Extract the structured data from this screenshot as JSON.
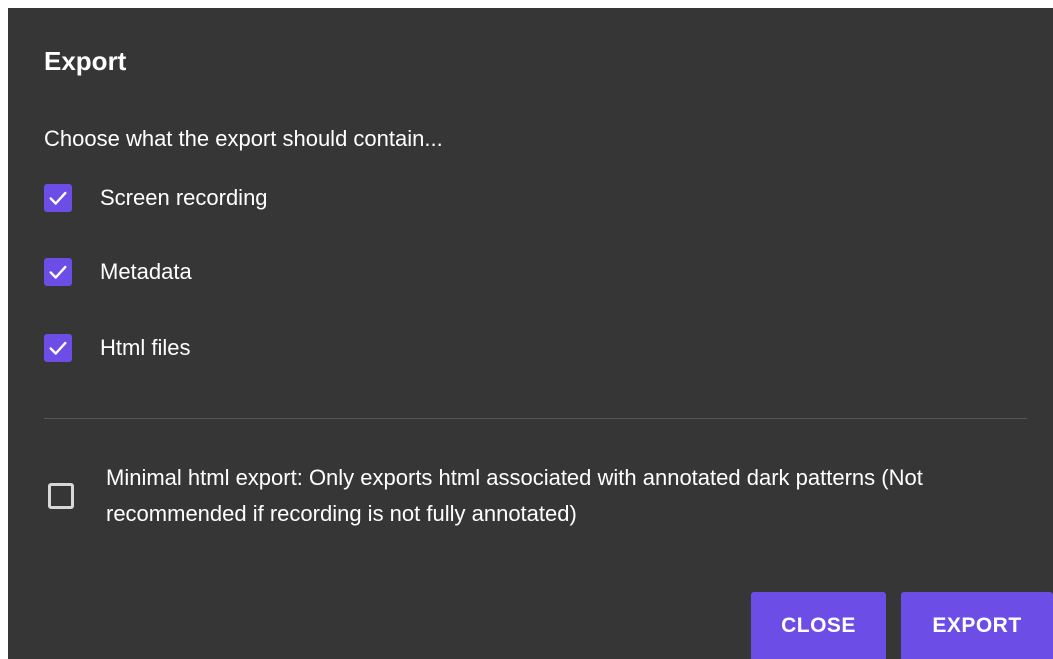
{
  "dialog": {
    "title": "Export",
    "subtitle": "Choose what the export should contain...",
    "options": [
      {
        "label": "Screen recording",
        "checked": true
      },
      {
        "label": "Metadata",
        "checked": true
      },
      {
        "label": "Html files",
        "checked": true
      }
    ],
    "minimal_option": {
      "label": "Minimal html export: Only exports html associated with annotated dark patterns (Not recommended if recording is not fully annotated)",
      "checked": false
    },
    "buttons": {
      "close_label": "CLOSE",
      "export_label": "EXPORT"
    }
  },
  "colors": {
    "background": "#363636",
    "accent": "#6c4ee6",
    "text": "#ffffff"
  },
  "icons": {
    "checked": "checkmark-icon"
  }
}
